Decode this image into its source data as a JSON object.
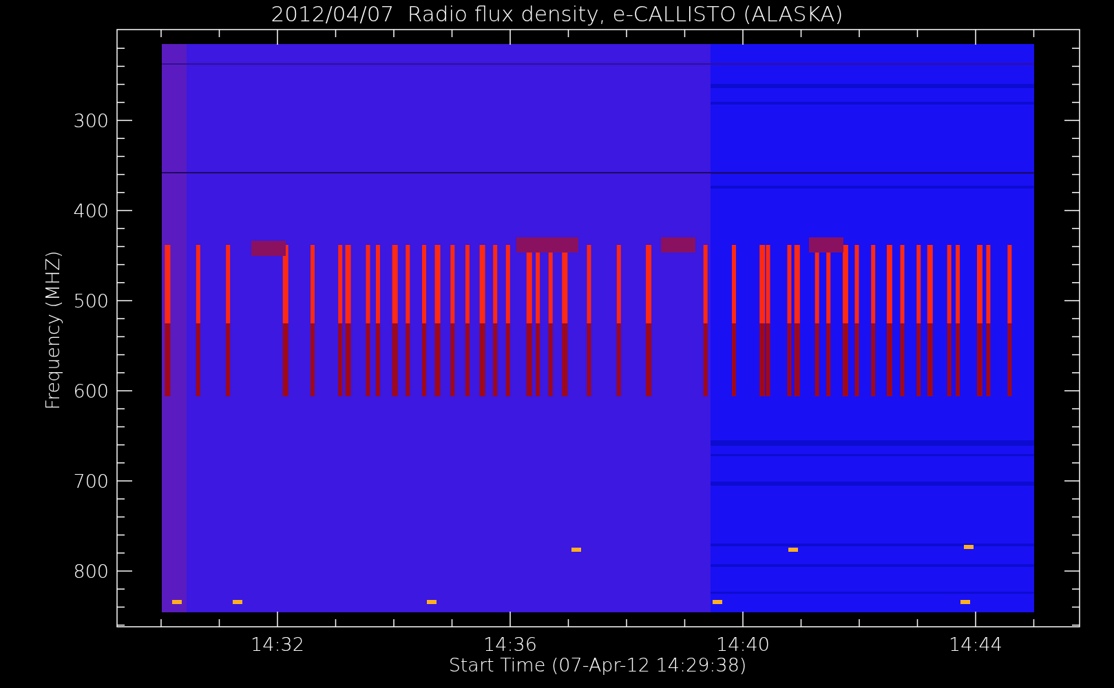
{
  "plot": {
    "title": "2012/04/07  Radio flux density, e-CALLISTO (ALASKA)",
    "ylabel": "Frequency (MHZ)",
    "xlabel": "Start Time (07-Apr-12 14:29:38)",
    "yticks": [
      "300",
      "400",
      "500",
      "600",
      "700",
      "800"
    ],
    "xticks": [
      "14:32",
      "14:36",
      "14:40",
      "14:44"
    ]
  }
}
